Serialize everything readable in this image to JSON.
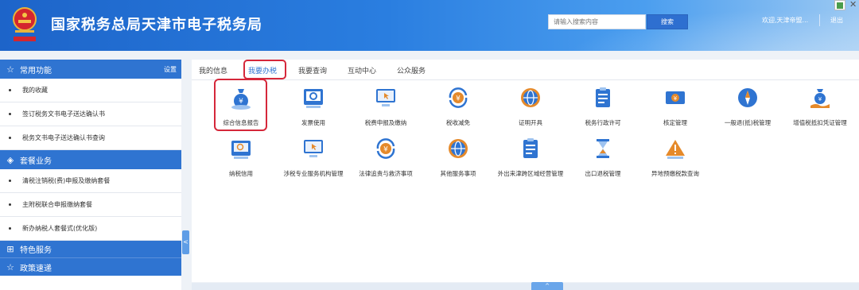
{
  "header": {
    "title": "国家税务总局天津市电子税务局",
    "search_placeholder": "请输入搜索内容",
    "search_button": "搜索",
    "welcome": "欢迎,天津帝盟...",
    "logout": "退出"
  },
  "sidebar": {
    "sections": [
      {
        "title": "常用功能",
        "icon": "star-icon",
        "action": "设置",
        "items": [
          "我的收藏",
          "签订税务文书电子送达确认书",
          "税务文书电子送达确认书查询"
        ]
      },
      {
        "title": "套餐业务",
        "icon": "layers-icon",
        "items": [
          "清税注销税(费)申报及缴纳套餐",
          "主附税联合申报缴纳套餐",
          "新办纳税人套餐式(优化版)"
        ]
      },
      {
        "title": "特色服务",
        "icon": "grid-icon",
        "items": []
      },
      {
        "title": "政策速递",
        "icon": "star-icon",
        "items": []
      }
    ],
    "collapse_glyph": "<"
  },
  "tabs": [
    {
      "label": "我的信息",
      "active": false
    },
    {
      "label": "我要办税",
      "active": true
    },
    {
      "label": "我要查询",
      "active": false
    },
    {
      "label": "互动中心",
      "active": false
    },
    {
      "label": "公众服务",
      "active": false
    }
  ],
  "services": [
    {
      "label": "综合信息报告",
      "icon": "money-bag-icon"
    },
    {
      "label": "发票使用",
      "icon": "invoice-icon"
    },
    {
      "label": "税费申报及缴纳",
      "icon": "monitor-icon"
    },
    {
      "label": "税收减免",
      "icon": "tax-relief-icon"
    },
    {
      "label": "证明开具",
      "icon": "globe-icon"
    },
    {
      "label": "税务行政许可",
      "icon": "clipboard-icon"
    },
    {
      "label": "核定管理",
      "icon": "ticket-icon"
    },
    {
      "label": "一般退(抵)税管理",
      "icon": "compass-icon"
    },
    {
      "label": "增值税抵扣凭证管理",
      "icon": "money-hand-icon"
    },
    {
      "label": "纳税信用",
      "icon": "credit-icon"
    },
    {
      "label": "涉税专业服务机构管理",
      "icon": "monitor-icon"
    },
    {
      "label": "法律追责与救济事项",
      "icon": "legal-icon"
    },
    {
      "label": "其他服务事项",
      "icon": "globe-icon"
    },
    {
      "label": "外出来津跨区域经营管理",
      "icon": "clipboard-icon"
    },
    {
      "label": "出口退税管理",
      "icon": "hourglass-icon"
    },
    {
      "label": "异地预缴税款查询",
      "icon": "warning-icon"
    }
  ],
  "footer": {
    "up_glyph": "^"
  },
  "colors": {
    "primary": "#2f74d1",
    "highlight": "#d5273a"
  }
}
